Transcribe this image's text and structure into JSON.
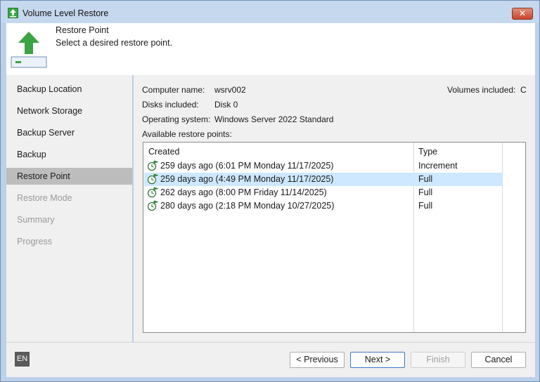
{
  "window": {
    "title": "Volume Level Restore",
    "close_label": "✕"
  },
  "header": {
    "title": "Restore Point",
    "subtitle": "Select a desired restore point."
  },
  "sidebar": {
    "items": [
      {
        "label": "Backup Location",
        "state": "enabled"
      },
      {
        "label": "Network Storage",
        "state": "enabled"
      },
      {
        "label": "Backup Server",
        "state": "enabled"
      },
      {
        "label": "Backup",
        "state": "enabled"
      },
      {
        "label": "Restore Point",
        "state": "active"
      },
      {
        "label": "Restore Mode",
        "state": "disabled"
      },
      {
        "label": "Summary",
        "state": "disabled"
      },
      {
        "label": "Progress",
        "state": "disabled"
      }
    ]
  },
  "info": {
    "computer_label": "Computer name:",
    "computer_value": "wsrv002",
    "disks_label": "Disks included:",
    "disks_value": "Disk 0",
    "os_label": "Operating system:",
    "os_value": "Windows Server 2022 Standard",
    "volumes_label": "Volumes included:",
    "volumes_value": "C",
    "list_caption": "Available restore points:"
  },
  "restore_points": {
    "columns": [
      "Created",
      "Type"
    ],
    "rows": [
      {
        "created": "259 days ago (6:01 PM Monday 11/17/2025)",
        "type": "Increment",
        "selected": false
      },
      {
        "created": "259 days ago (4:49 PM Monday 11/17/2025)",
        "type": "Full",
        "selected": true
      },
      {
        "created": "262 days ago (8:00 PM Friday 11/14/2025)",
        "type": "Full",
        "selected": false
      },
      {
        "created": "280 days ago (2:18 PM Monday 10/27/2025)",
        "type": "Full",
        "selected": false
      }
    ]
  },
  "footer": {
    "language": "EN",
    "previous_label": "< Previous",
    "next_label": "Next >",
    "finish_label": "Finish",
    "cancel_label": "Cancel"
  },
  "colors": {
    "accent_green": "#3aa344",
    "selection": "#cde8ff",
    "active_nav": "#bdbdbd"
  },
  "icons": {
    "app": "restore-arrow-icon",
    "header": "upload-arrow-icon",
    "row": "restore-point-clock-icon"
  }
}
